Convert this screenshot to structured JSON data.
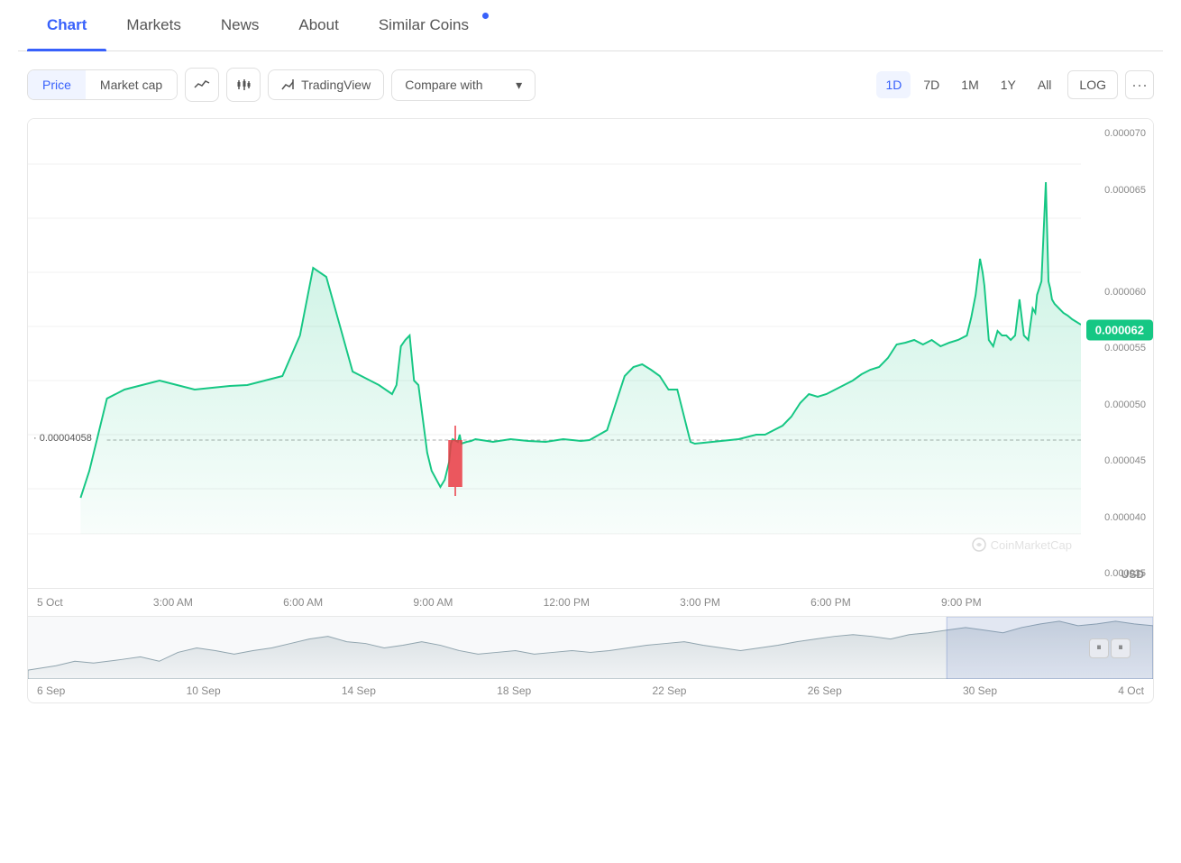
{
  "tabs": [
    {
      "label": "Chart",
      "active": true,
      "dot": false
    },
    {
      "label": "Markets",
      "active": false,
      "dot": false
    },
    {
      "label": "News",
      "active": false,
      "dot": false
    },
    {
      "label": "About",
      "active": false,
      "dot": false
    },
    {
      "label": "Similar Coins",
      "active": false,
      "dot": true
    }
  ],
  "toolbar": {
    "price_label": "Price",
    "market_cap_label": "Market cap",
    "trading_view_label": "TradingView",
    "compare_with_label": "Compare with",
    "time_buttons": [
      "1D",
      "7D",
      "1M",
      "1Y",
      "All"
    ],
    "active_time": "1D",
    "log_label": "LOG",
    "more_label": "···"
  },
  "chart": {
    "price_badge": "0.000062",
    "open_price": "· 0.00004058",
    "watermark": "CoinMarketCap",
    "usd_label": "USD",
    "y_labels": [
      "0.000070",
      "0.000065",
      "0.000062",
      "0.000060",
      "0.000055",
      "0.000050",
      "0.000045",
      "0.000040",
      "0.000035"
    ],
    "x_labels": [
      "5 Oct",
      "3:00 AM",
      "6:00 AM",
      "9:00 AM",
      "12:00 PM",
      "3:00 PM",
      "6:00 PM",
      "9:00 PM",
      ""
    ],
    "x_labels_bottom": [
      "6 Sep",
      "10 Sep",
      "14 Sep",
      "18 Sep",
      "22 Sep",
      "26 Sep",
      "30 Sep",
      "4 Oct"
    ]
  }
}
